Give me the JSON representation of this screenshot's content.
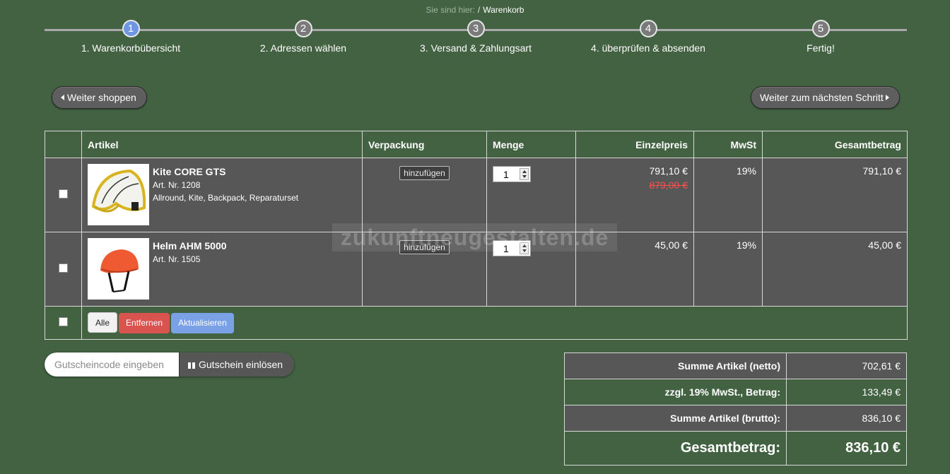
{
  "breadcrumb": {
    "label": "Sie sind hier:",
    "separator": "/",
    "current": "Warenkorb"
  },
  "steps": [
    {
      "number": "1",
      "label": "1. Warenkorbübersicht",
      "active": true
    },
    {
      "number": "2",
      "label": "2. Adressen wählen",
      "active": false
    },
    {
      "number": "3",
      "label": "3. Versand & Zahlungsart",
      "active": false
    },
    {
      "number": "4",
      "label": "4. überprüfen & absenden",
      "active": false
    },
    {
      "number": "5",
      "label": "Fertig!",
      "active": false
    }
  ],
  "nav": {
    "back_label": "Weiter shoppen",
    "next_label": "Weiter zum nächsten Schritt"
  },
  "table": {
    "headers": {
      "artikel": "Artikel",
      "verpackung": "Verpackung",
      "menge": "Menge",
      "einzelpreis": "Einzelpreis",
      "mwst": "MwSt",
      "gesamtbetrag": "Gesamtbetrag"
    },
    "items": [
      {
        "name": "Kite CORE GTS",
        "art_nr": "Art. Nr. 1208",
        "desc": "Allround, Kite, Backpack, Reparaturset",
        "pack_button": "hinzufügen",
        "qty": "1",
        "price": "791,10 €",
        "old_price": "879,00 €",
        "mwst": "19%",
        "total": "791,10 €"
      },
      {
        "name": "Helm AHM 5000",
        "art_nr": "Art. Nr. 1505",
        "desc": "",
        "pack_button": "hinzufügen",
        "qty": "1",
        "price": "45,00 €",
        "old_price": "",
        "mwst": "19%",
        "total": "45,00 €"
      }
    ],
    "actions": {
      "all": "Alle",
      "remove": "Entfernen",
      "update": "Aktualisieren"
    }
  },
  "coupon": {
    "placeholder": "Gutscheincode eingeben",
    "button": "Gutschein einlösen"
  },
  "totals": [
    {
      "label": "Summe Artikel (netto)",
      "value": "702,61 €"
    },
    {
      "label": "zzgl. 19% MwSt., Betrag:",
      "value": "133,49 €"
    },
    {
      "label": "Summe Artikel (brutto):",
      "value": "836,10 €"
    },
    {
      "label": "Gesamtbetrag:",
      "value": "836,10 €"
    }
  ],
  "watermark": "zukunftneugestalten.de",
  "colors": {
    "background": "#426242",
    "row_gray": "#575757",
    "step_active": "#6d97e3",
    "remove_button": "#d9534f",
    "update_button": "#7aa0e6",
    "old_price": "#ff4d4d"
  }
}
